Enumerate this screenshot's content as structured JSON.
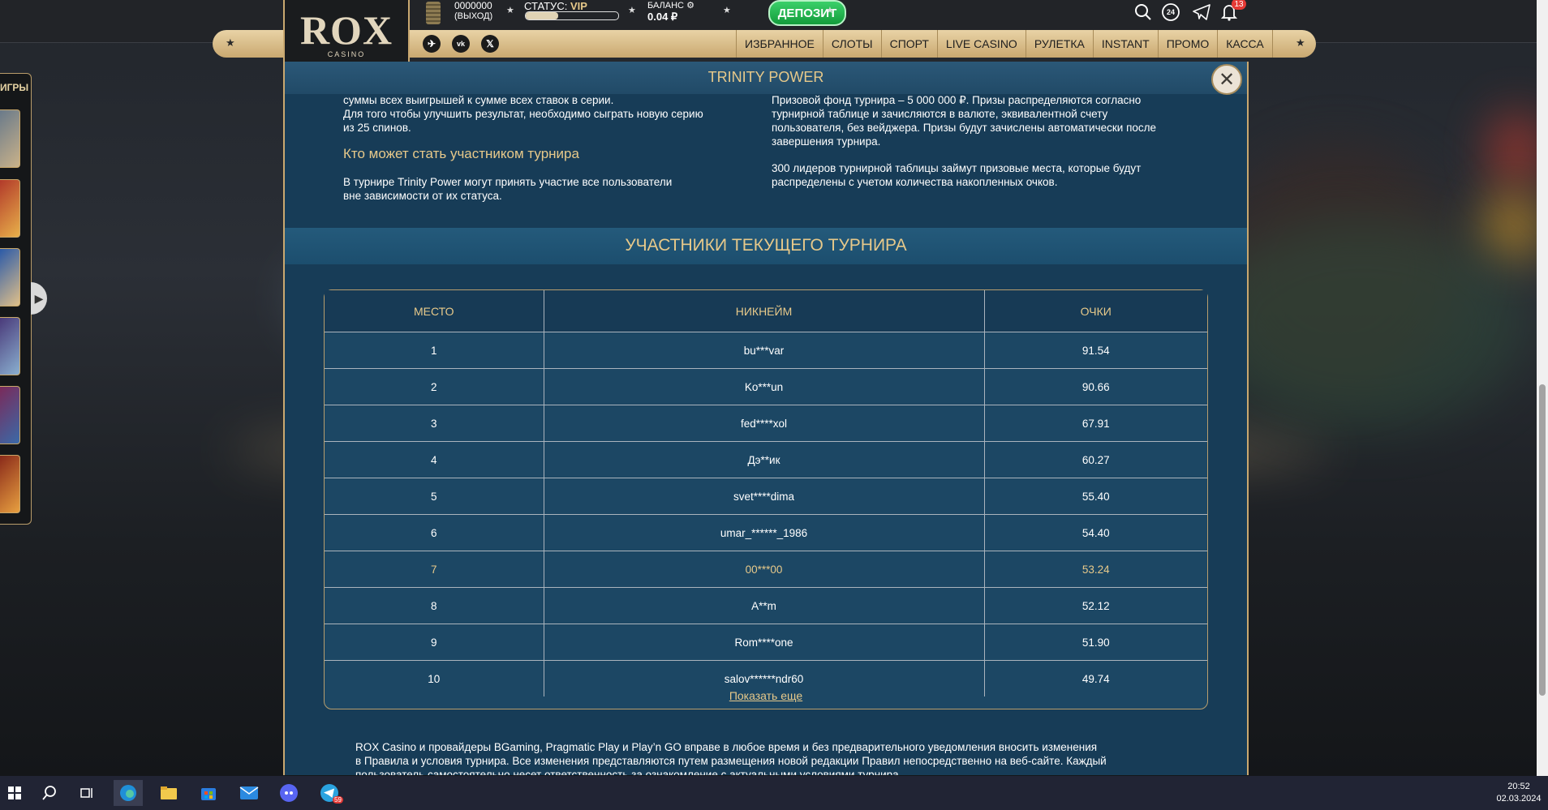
{
  "header": {
    "logo_text": "ROX",
    "logo_sub": "CASINO",
    "account_id": "0000000",
    "logout_label": "(ВЫХОД)",
    "status_label": "СТАТУС:",
    "status_value": "VIP",
    "status_progress": 0.35,
    "balance_label": "БАЛАНС",
    "balance_value": "0.04 ₽",
    "deposit_label": "ДЕПОЗИТ",
    "notifications_count": "13",
    "support_label": "24"
  },
  "nav": {
    "items": [
      "ИЗБРАННОЕ",
      "СЛОТЫ",
      "СПОРТ",
      "LIVE CASINO",
      "РУЛЕТКА",
      "INSTANT",
      "ПРОМО",
      "КАССА"
    ]
  },
  "sidebar": {
    "title": "ИГРЫ"
  },
  "modal": {
    "title": "TRINITY POWER",
    "left_text_1": "суммы всех выигрышей к сумме всех ставок в серии.",
    "left_text_2": "Для того чтобы улучшить результат, необходимо сыграть новую серию",
    "left_text_3": "из 25 спинов.",
    "who_heading": "Кто может стать участником турнира",
    "who_text_1": "В турнире Trinity Power могут принять участие все пользователи",
    "who_text_2": "вне зависимости от их статуса.",
    "right_text_1": "Призовой фонд турнира – 5 000 000 ₽. Призы распределяются согласно",
    "right_text_2": "турнирной таблице и зачисляются в валюте, эквивалентной счету",
    "right_text_3": "пользователя, без вейджера. Призы будут зачислены автоматически после",
    "right_text_4": "завершения турнира.",
    "right_text_5": "300 лидеров турнирной таблицы займут призовые места, которые будут",
    "right_text_6": "распределены с учетом количества накопленных очков.",
    "participants_title": "УЧАСТНИКИ ТЕКУЩЕГО ТУРНИРА",
    "table_headers": [
      "МЕСТО",
      "НИКНЕЙМ",
      "ОЧКИ"
    ],
    "rows": [
      {
        "place": "1",
        "nick": "bu***var",
        "points": "91.54"
      },
      {
        "place": "2",
        "nick": "Ko***un",
        "points": "90.66"
      },
      {
        "place": "3",
        "nick": "fed****xol",
        "points": "67.91"
      },
      {
        "place": "4",
        "nick": "Дэ**ик",
        "points": "60.27"
      },
      {
        "place": "5",
        "nick": "svet****dima",
        "points": "55.40"
      },
      {
        "place": "6",
        "nick": "umar_******_1986",
        "points": "54.40"
      },
      {
        "place": "7",
        "nick": "00***00",
        "points": "53.24"
      },
      {
        "place": "8",
        "nick": "A**m",
        "points": "52.12"
      },
      {
        "place": "9",
        "nick": "Rom****one",
        "points": "51.90"
      },
      {
        "place": "10",
        "nick": "salov******ndr60",
        "points": "49.74"
      }
    ],
    "highlight_place": "7",
    "show_more": "Показать еще",
    "footer_1": "ROX Casino и провайдеры BGaming, Pragmatic Play и Play’n GO вправе в любое время и без предварительного уведомления вносить изменения",
    "footer_2": "в Правила и условия турнира. Все изменения представляются путем размещения новой редакции Правил непосредственно на веб-сайте. Каждый",
    "footer_3": "пользователь самостоятельно несет ответственность за ознакомление с актуальными условиями турнира."
  },
  "taskbar": {
    "time": "20:52",
    "date": "02.03.2024",
    "telegram_badge": "59"
  },
  "colors": {
    "gold": "#e7c98a",
    "modal_bg": "#173c57",
    "deposit_green": "#22b24c"
  }
}
